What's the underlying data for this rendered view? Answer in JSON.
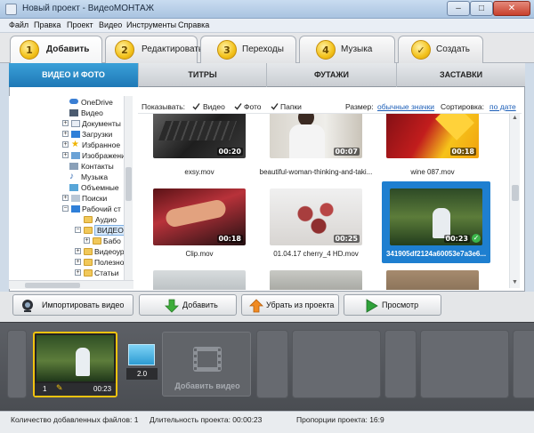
{
  "window": {
    "title": "Новый проект - ВидеоМОНТАЖ"
  },
  "menu": [
    "Файл",
    "Правка",
    "Проект",
    "Видео",
    "Инструменты",
    "Справка"
  ],
  "wizard_tabs": [
    {
      "num": "1",
      "label": "Добавить",
      "active": true
    },
    {
      "num": "2",
      "label": "Редактировать"
    },
    {
      "num": "3",
      "label": "Переходы"
    },
    {
      "num": "4",
      "label": "Музыка"
    },
    {
      "num": "",
      "label": "Создать",
      "icon": "check-icon"
    }
  ],
  "sub_tabs": [
    {
      "label": "ВИДЕО И ФОТО",
      "active": true
    },
    {
      "label": "ТИТРЫ"
    },
    {
      "label": "ФУТАЖИ"
    },
    {
      "label": "ЗАСТАВКИ"
    }
  ],
  "tree": [
    {
      "label": "OneDrive",
      "icon": "cloud-icon"
    },
    {
      "label": "Видео",
      "icon": "video-folder-icon"
    },
    {
      "label": "Документы",
      "icon": "documents-icon"
    },
    {
      "label": "Загрузки",
      "icon": "downloads-icon"
    },
    {
      "label": "Избранное",
      "icon": "star-icon"
    },
    {
      "label": "Изображени",
      "icon": "images-icon"
    },
    {
      "label": "Контакты",
      "icon": "contacts-icon"
    },
    {
      "label": "Музыка",
      "icon": "music-icon"
    },
    {
      "label": "Объемные",
      "icon": "3d-objects-icon"
    },
    {
      "label": "Поиски",
      "icon": "search-folder-icon"
    },
    {
      "label": "Рабочий ст",
      "icon": "desktop-icon"
    },
    {
      "label": "Аудио",
      "icon": "folder-icon"
    },
    {
      "label": "ВИДЕО",
      "icon": "folder-icon",
      "selected": true
    },
    {
      "label": "Бабо",
      "icon": "folder-icon"
    },
    {
      "label": "Видеоур",
      "icon": "folder-icon"
    },
    {
      "label": "Полезно",
      "icon": "folder-icon"
    },
    {
      "label": "Статьи",
      "icon": "folder-icon"
    }
  ],
  "filters": {
    "show_label": "Показывать:",
    "video": "Видео",
    "photo": "Фото",
    "folders": "Папки",
    "size_label": "Размер:",
    "size_value": "обычные значки",
    "sort_label": "Сортировка:",
    "sort_value": "по дате"
  },
  "media": [
    {
      "name": "exsy.mov",
      "duration": "00:20"
    },
    {
      "name": "beautiful-woman-thinking-and-taki...",
      "duration": "00:07"
    },
    {
      "name": "wine 087.mov",
      "duration": "00:18"
    },
    {
      "name": "Clip.mov",
      "duration": "00:18"
    },
    {
      "name": "01.04.17 cherry_4 HD.mov",
      "duration": "00:25"
    },
    {
      "name": "341905df2124a60053e7a3e6...",
      "duration": "00:23",
      "selected": true
    },
    {
      "name": "",
      "duration": ""
    },
    {
      "name": "",
      "duration": ""
    },
    {
      "name": "",
      "duration": ""
    }
  ],
  "actions": {
    "import": "Импортировать видео",
    "add": "Добавить",
    "remove": "Убрать из проекта",
    "preview": "Просмотр"
  },
  "timeline": {
    "clip_index": "1",
    "clip_duration": "00:23",
    "transition_value": "2.0",
    "add_video_label": "Добавить видео"
  },
  "status": {
    "files": "Количество добавленных файлов: 1",
    "duration": "Длительность проекта: 00:00:23",
    "aspect": "Пропорции проекта: 16:9"
  }
}
